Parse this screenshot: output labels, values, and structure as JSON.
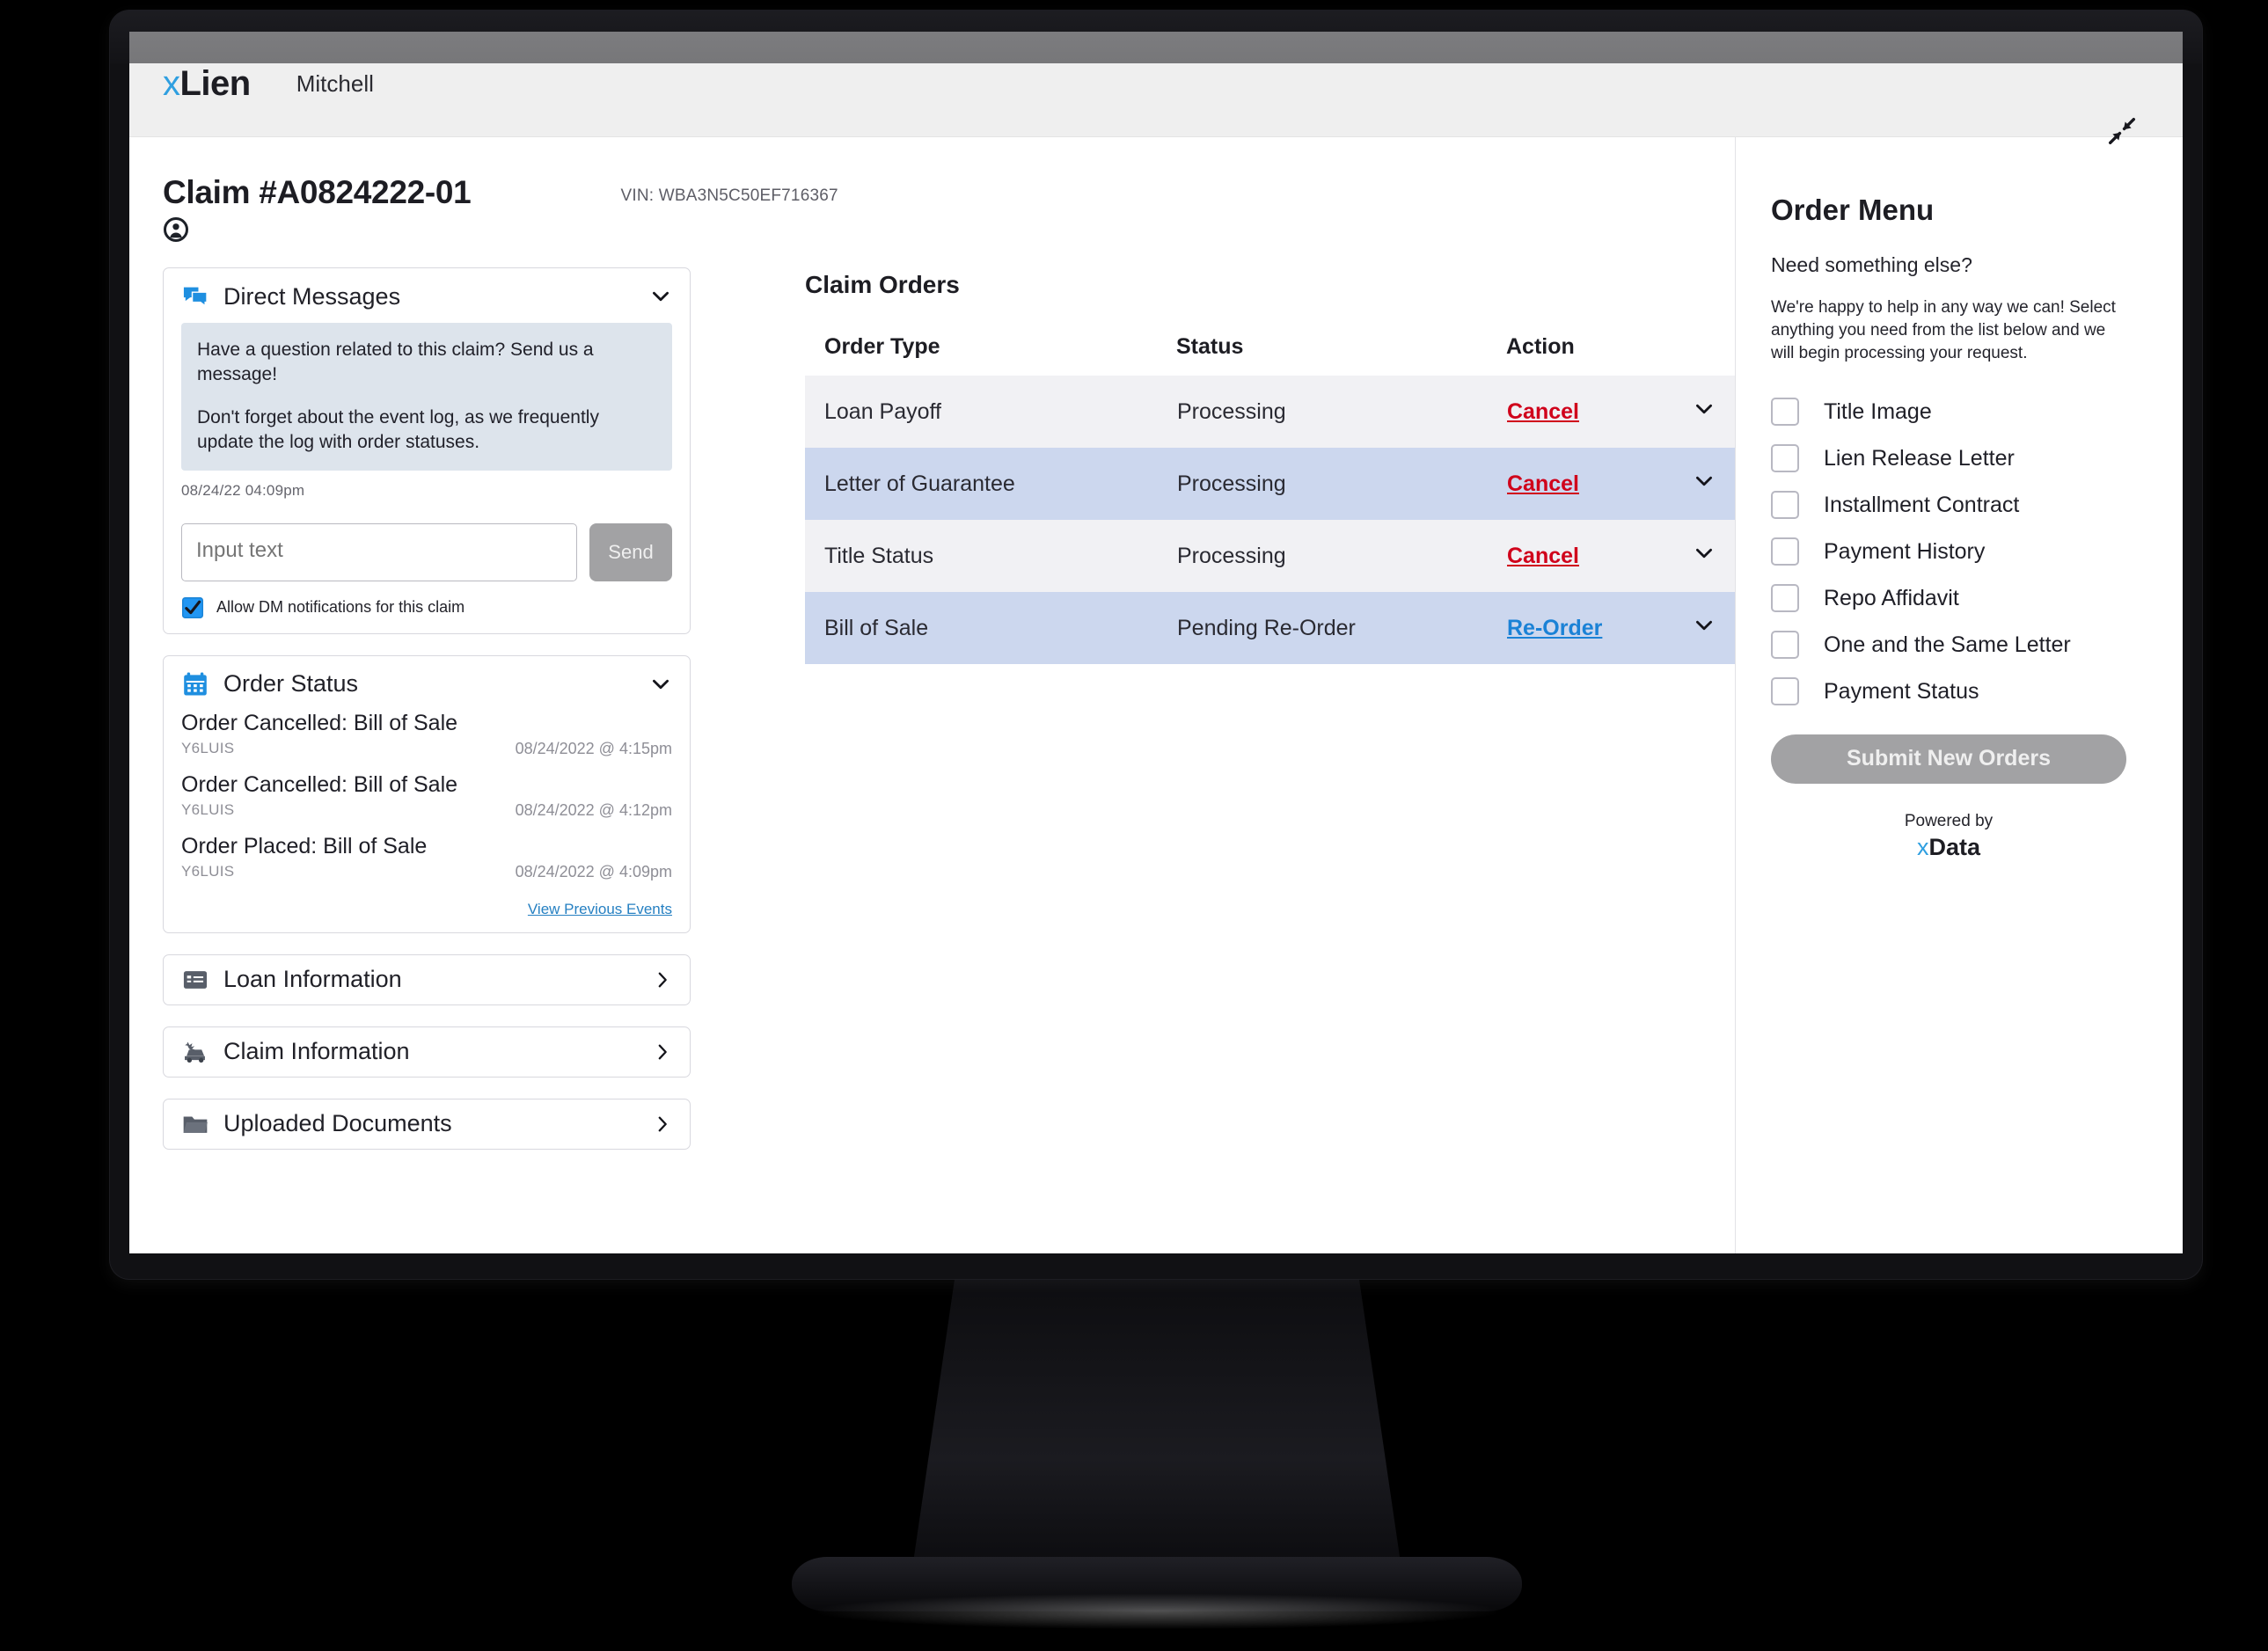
{
  "app": {
    "logo_x": "x",
    "logo_rest": "Lien",
    "brand": "Mitchell"
  },
  "claim": {
    "title": "Claim #A0824222-01",
    "vin": "VIN: WBA3N5C50EF716367"
  },
  "direct_messages": {
    "title": "Direct Messages",
    "message_1": "Have a question related to this claim? Send us a message!",
    "message_2": "Don't forget about the event log, as we frequently update the log with order statuses.",
    "timestamp": "08/24/22 04:09pm",
    "input_placeholder": "Input text",
    "input_value": "",
    "send_label": "Send",
    "notify_label": "Allow DM notifications for this claim",
    "notify_checked": "true"
  },
  "order_status": {
    "title": "Order Status",
    "events": [
      {
        "title": "Order Cancelled: Bill of Sale",
        "user": "Y6LUIS",
        "when": "08/24/2022 @ 4:15pm"
      },
      {
        "title": "Order Cancelled: Bill of Sale",
        "user": "Y6LUIS",
        "when": "08/24/2022 @ 4:12pm"
      },
      {
        "title": "Order Placed: Bill of Sale",
        "user": "Y6LUIS",
        "when": "08/24/2022 @ 4:09pm"
      }
    ],
    "view_previous": "View Previous Events"
  },
  "accordions": [
    {
      "label": "Loan Information",
      "icon": "credit-card-icon"
    },
    {
      "label": "Claim Information",
      "icon": "car-crash-icon"
    },
    {
      "label": "Uploaded Documents",
      "icon": "folder-icon"
    }
  ],
  "claim_orders": {
    "title": "Claim Orders",
    "columns": [
      "Order Type",
      "Status",
      "Action"
    ],
    "rows": [
      {
        "order_type": "Loan Payoff",
        "status": "Processing",
        "status_alert": false,
        "action": "Cancel",
        "action_kind": "cancel"
      },
      {
        "order_type": "Letter of Guarantee",
        "status": "Processing",
        "status_alert": false,
        "action": "Cancel",
        "action_kind": "cancel"
      },
      {
        "order_type": "Title Status",
        "status": "Processing",
        "status_alert": false,
        "action": "Cancel",
        "action_kind": "cancel"
      },
      {
        "order_type": "Bill of Sale",
        "status": "Pending Re-Order",
        "status_alert": true,
        "action": "Re-Order",
        "action_kind": "reorder"
      }
    ]
  },
  "order_menu": {
    "title": "Order Menu",
    "question": "Need something else?",
    "description": "We're happy to help in any way we can! Select anything you need from the list below and we will begin processing your request.",
    "options": [
      "Title Image",
      "Lien Release Letter",
      "Installment Contract",
      "Payment History",
      "Repo Affidavit",
      "One and the Same Letter",
      "Payment Status"
    ],
    "submit_label": "Submit New Orders",
    "powered_by": "Powered by",
    "powered_brand_x": "x",
    "powered_brand_rest": "Data"
  },
  "colors": {
    "accent_blue": "#2f9fe0",
    "link_blue": "#1b82d6",
    "danger_red": "#d0021b",
    "row_alt": "#ccd7ee",
    "row_base": "#f1f1f4",
    "bubble_bg": "#dde4ec"
  }
}
